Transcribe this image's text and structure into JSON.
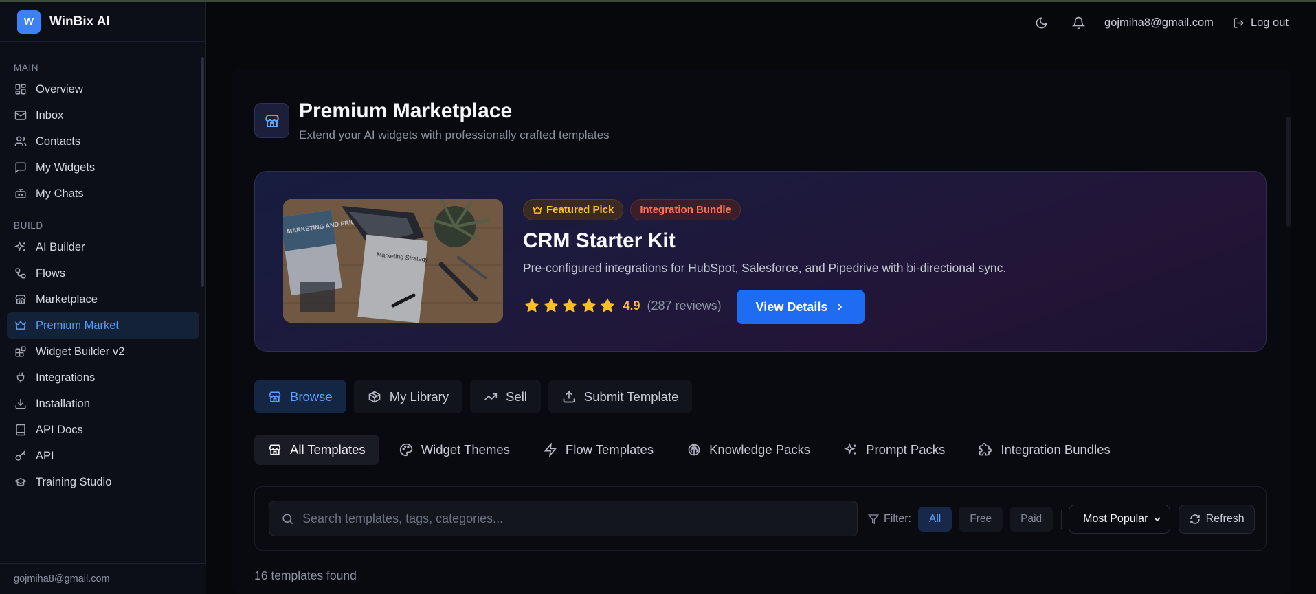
{
  "app": {
    "logo_letter": "W",
    "name": "WinBix AI"
  },
  "sidebar": {
    "sections": [
      {
        "label": "MAIN",
        "items": [
          {
            "label": "Overview",
            "icon": "grid-icon"
          },
          {
            "label": "Inbox",
            "icon": "mail-icon"
          },
          {
            "label": "Contacts",
            "icon": "users-icon"
          },
          {
            "label": "My Widgets",
            "icon": "message-square-icon"
          },
          {
            "label": "My Chats",
            "icon": "bot-icon"
          }
        ]
      },
      {
        "label": "BUILD",
        "items": [
          {
            "label": "AI Builder",
            "icon": "sparkles-icon"
          },
          {
            "label": "Flows",
            "icon": "workflow-icon"
          },
          {
            "label": "Marketplace",
            "icon": "store-icon"
          },
          {
            "label": "Premium Market",
            "icon": "crown-icon",
            "active": true
          },
          {
            "label": "Widget Builder v2",
            "icon": "blocks-icon"
          },
          {
            "label": "Integrations",
            "icon": "plug-icon"
          },
          {
            "label": "Installation",
            "icon": "download-icon"
          },
          {
            "label": "API Docs",
            "icon": "book-icon"
          },
          {
            "label": "API",
            "icon": "key-icon"
          },
          {
            "label": "Training Studio",
            "icon": "graduation-cap-icon"
          }
        ]
      }
    ],
    "footer_email": "gojmiha8@gmail.com"
  },
  "topbar": {
    "email": "gojmiha8@gmail.com",
    "logout_label": "Log out"
  },
  "page": {
    "title": "Premium Marketplace",
    "subtitle": "Extend your AI widgets with professionally crafted templates"
  },
  "featured": {
    "badge_featured": "Featured Pick",
    "badge_category": "Integration Bundle",
    "title": "CRM Starter Kit",
    "description": "Pre-configured integrations for HubSpot, Salesforce, and Pipedrive with bi-directional sync.",
    "rating": "4.9",
    "rating_stars": 5,
    "reviews": "(287 reviews)",
    "cta_label": "View Details",
    "image_text": {
      "book": "MARKETING AND PRICING",
      "paper": "Marketing Strategy"
    }
  },
  "main_tabs": [
    {
      "label": "Browse",
      "icon": "store-icon",
      "active": true
    },
    {
      "label": "My Library",
      "icon": "package-icon"
    },
    {
      "label": "Sell",
      "icon": "trending-up-icon"
    },
    {
      "label": "Submit Template",
      "icon": "upload-icon"
    }
  ],
  "category_tabs": [
    {
      "label": "All Templates",
      "icon": "store-icon",
      "active": true
    },
    {
      "label": "Widget Themes",
      "icon": "palette-icon"
    },
    {
      "label": "Flow Templates",
      "icon": "zap-icon"
    },
    {
      "label": "Knowledge Packs",
      "icon": "brain-icon"
    },
    {
      "label": "Prompt Packs",
      "icon": "sparkles-icon"
    },
    {
      "label": "Integration Bundles",
      "icon": "puzzle-icon"
    }
  ],
  "search": {
    "placeholder": "Search templates, tags, categories...",
    "value": ""
  },
  "filter": {
    "label": "Filter:",
    "options": [
      "All",
      "Free",
      "Paid"
    ],
    "selected": "All",
    "sort_selected": "Most Popular",
    "refresh_label": "Refresh"
  },
  "results_text": "16 templates found",
  "colors": {
    "accent": "#1d6cf2",
    "star": "#fbbf24",
    "badge_orange": "#f97355"
  }
}
